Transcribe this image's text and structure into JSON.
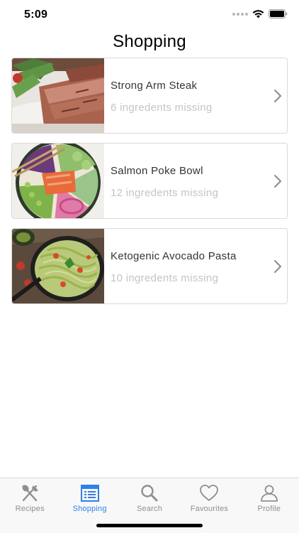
{
  "status_bar": {
    "time": "5:09"
  },
  "page": {
    "title": "Shopping"
  },
  "recipes": [
    {
      "name": "Strong Arm Steak",
      "missing": "6 ingredents missing"
    },
    {
      "name": "Salmon Poke Bowl",
      "missing": "12 ingredents missing"
    },
    {
      "name": "Ketogenic Avocado Pasta",
      "missing": "10 ingredents missing"
    }
  ],
  "tab_bar": {
    "active": "Shopping",
    "accent_color": "#2f80ed",
    "inactive_color": "#8e8e93",
    "tabs": [
      {
        "label": "Recipes",
        "icon": "fork-knife-icon"
      },
      {
        "label": "Shopping",
        "icon": "shopping-list-icon"
      },
      {
        "label": "Search",
        "icon": "search-icon"
      },
      {
        "label": "Favourites",
        "icon": "heart-icon"
      },
      {
        "label": "Profile",
        "icon": "person-icon"
      }
    ]
  }
}
